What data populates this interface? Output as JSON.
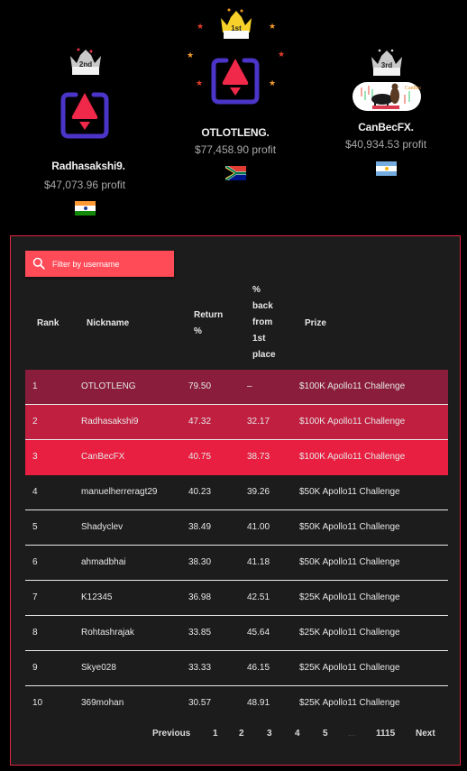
{
  "podium": [
    {
      "rank_badge": "2nd",
      "name": "Radhasakshi9.",
      "profit": "$47,073.96 profit",
      "country": "India",
      "avatar": "brand-logo",
      "crown": "silver"
    },
    {
      "rank_badge": "1st",
      "name": "OTLOTLENG.",
      "profit": "$77,458.90 profit",
      "country": "South Africa",
      "avatar": "brand-logo",
      "crown": "gold"
    },
    {
      "rank_badge": "3rd",
      "name": "CanBecFX.",
      "profit": "$40,934.53 profit",
      "country": "Argentina",
      "avatar": "bull-bear-photo",
      "crown": "silver"
    }
  ],
  "colors": {
    "accent": "#e0253f",
    "search_bg": "#ff4a57",
    "row1_bg": "#8a1d3c",
    "row2_bg": "#c01f40",
    "row3_bg": "#e81f41",
    "panel_bg": "#1c1c1c",
    "logo_frame": "#4a35c8",
    "logo_arrow": "#f0284a"
  },
  "search": {
    "placeholder": "Filter by username",
    "value": "",
    "icon": "search-icon"
  },
  "table": {
    "headers": {
      "rank": "Rank",
      "nickname": "Nickname",
      "return": [
        "Return",
        "%"
      ],
      "back": [
        "%",
        "back",
        "from",
        "1st",
        "place"
      ],
      "prize": "Prize"
    },
    "rows": [
      {
        "rank": "1",
        "nickname": "OTLOTLENG",
        "return": "79.50",
        "back": "–",
        "prize": "$100K Apollo11 Challenge"
      },
      {
        "rank": "2",
        "nickname": "Radhasakshi9",
        "return": "47.32",
        "back": "32.17",
        "prize": "$100K Apollo11 Challenge"
      },
      {
        "rank": "3",
        "nickname": "CanBecFX",
        "return": "40.75",
        "back": "38.73",
        "prize": "$100K Apollo11 Challenge"
      },
      {
        "rank": "4",
        "nickname": "manuelherreragt29",
        "return": "40.23",
        "back": "39.26",
        "prize": "$50K Apollo11 Challenge"
      },
      {
        "rank": "5",
        "nickname": "Shadyclev",
        "return": "38.49",
        "back": "41.00",
        "prize": "$50K Apollo11 Challenge"
      },
      {
        "rank": "6",
        "nickname": "ahmadbhai",
        "return": "38.30",
        "back": "41.18",
        "prize": "$50K Apollo11 Challenge"
      },
      {
        "rank": "7",
        "nickname": "K12345",
        "return": "36.98",
        "back": "42.51",
        "prize": "$25K Apollo11 Challenge"
      },
      {
        "rank": "8",
        "nickname": "Rohtashrajak",
        "return": "33.85",
        "back": "45.64",
        "prize": "$25K Apollo11 Challenge"
      },
      {
        "rank": "9",
        "nickname": "Skye028",
        "return": "33.33",
        "back": "46.15",
        "prize": "$25K Apollo11 Challenge"
      },
      {
        "rank": "10",
        "nickname": "369mohan",
        "return": "30.57",
        "back": "48.91",
        "prize": "$25K Apollo11 Challenge"
      }
    ]
  },
  "pagination": {
    "previous": "Previous",
    "pages": [
      "1",
      "2",
      "3",
      "4",
      "5"
    ],
    "ellipsis": "...",
    "last": "1115",
    "next": "Next"
  }
}
